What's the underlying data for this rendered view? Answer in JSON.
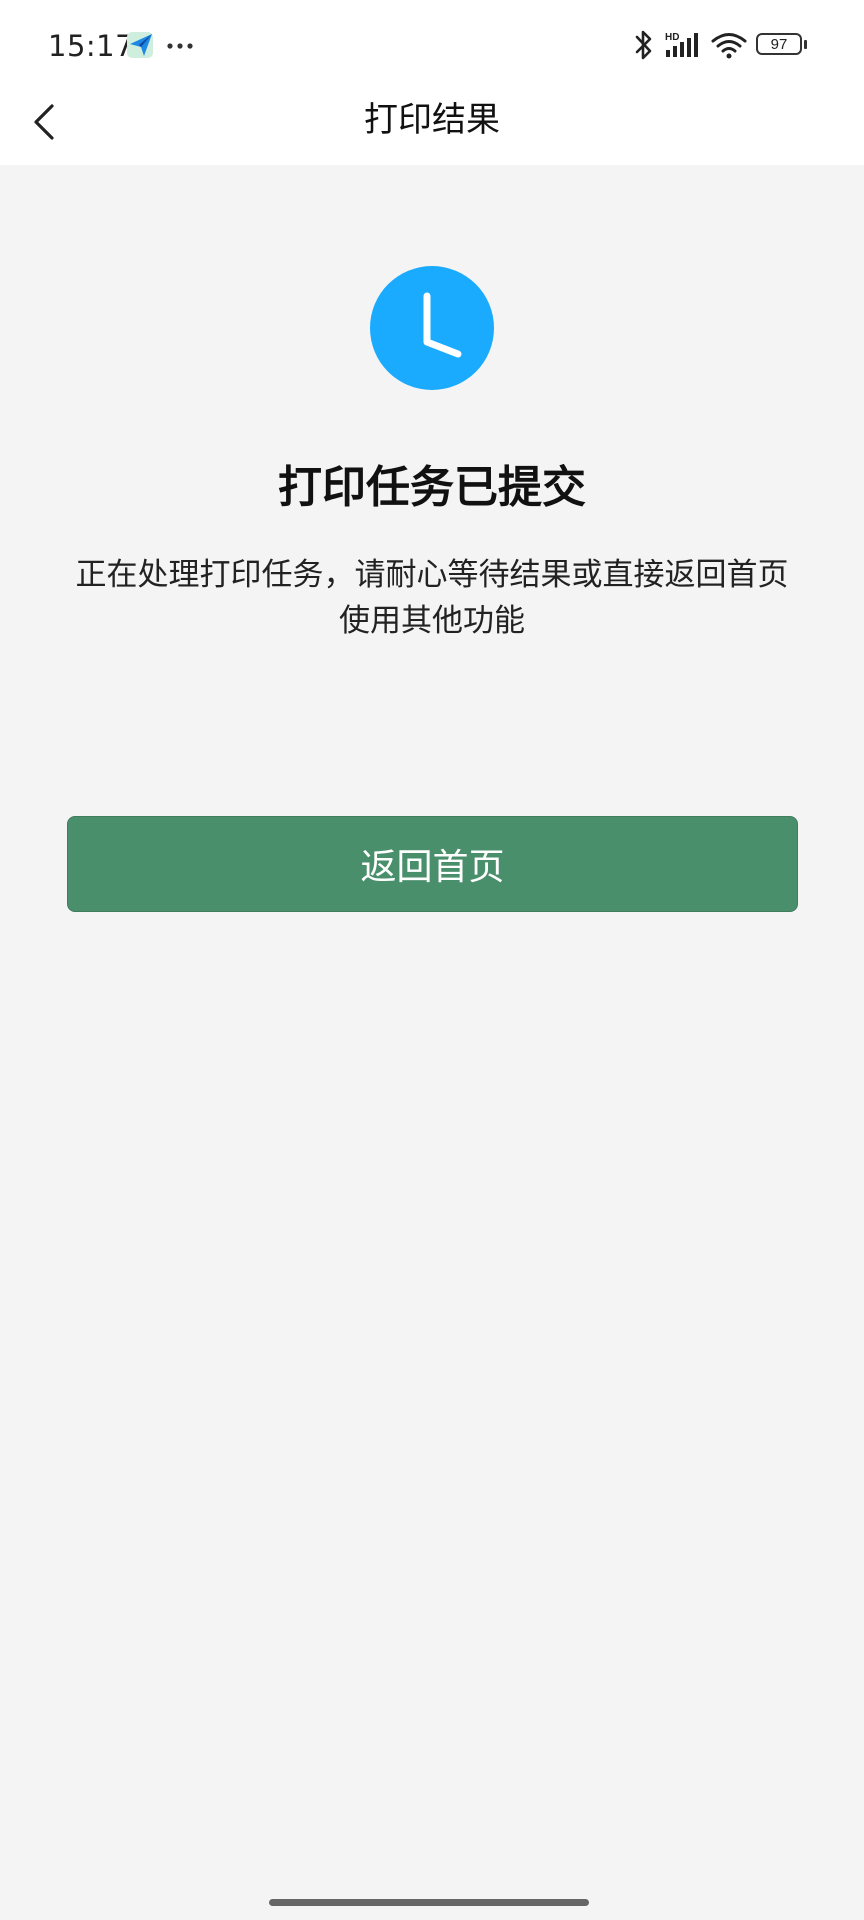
{
  "status_bar": {
    "time": "15:17",
    "battery_level": "97",
    "network_badge": "HD",
    "icons": [
      "app-notification-icon",
      "more-dots-icon",
      "bluetooth-icon",
      "signal-icon",
      "wifi-icon",
      "battery-icon"
    ]
  },
  "nav": {
    "title": "打印结果",
    "back_icon": "chevron-left-icon"
  },
  "result": {
    "icon": "clock-icon",
    "icon_color": "#1aabff",
    "title": "打印任务已提交",
    "description": "正在处理打印任务，请耐心等待结果或直接返回首页使用其他功能"
  },
  "actions": {
    "home_button_label": "返回首页",
    "home_button_color": "#4a8f6c"
  }
}
